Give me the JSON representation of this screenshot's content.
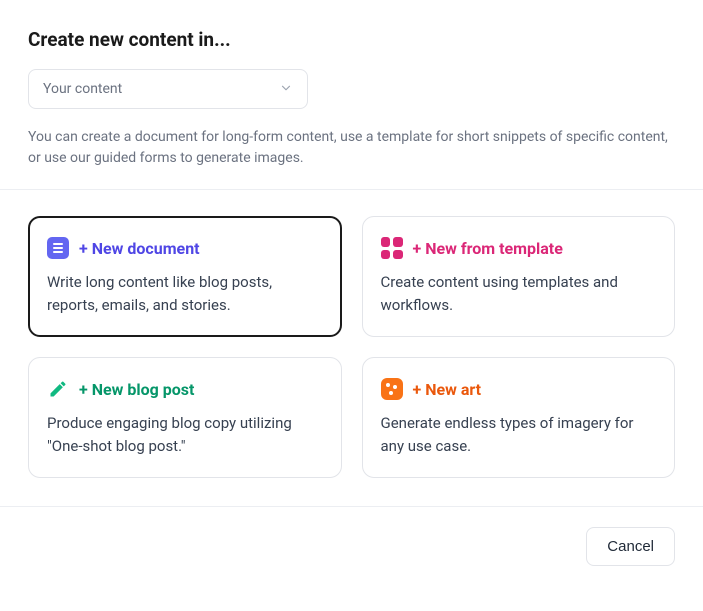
{
  "header": {
    "title": "Create new content in...",
    "dropdown_label": "Your content",
    "description": "You can create a document for long-form content, use a template for short snippets of specific content, or use our guided forms to generate images."
  },
  "cards": {
    "document": {
      "title": "+ New document",
      "desc": "Write long content like blog posts, reports, emails, and stories."
    },
    "template": {
      "title": "+ New from template",
      "desc": "Create content using templates and workflows."
    },
    "blog": {
      "title": "+ New blog post",
      "desc": "Produce engaging blog copy utilizing \"One-shot blog post.\""
    },
    "art": {
      "title": "+ New art",
      "desc": "Generate endless types of imagery for any use case."
    }
  },
  "footer": {
    "cancel": "Cancel"
  }
}
